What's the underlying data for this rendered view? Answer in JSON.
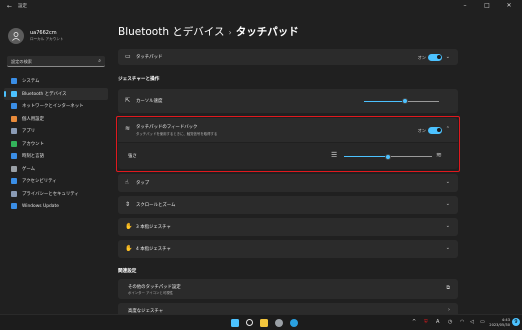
{
  "window": {
    "title": "設定",
    "back_glyph": "←",
    "minimize_glyph": "–",
    "maximize_glyph": "□",
    "close_glyph": "✕"
  },
  "user": {
    "name": "ua7662cm",
    "account": "ローカル アカウント"
  },
  "search": {
    "placeholder": "設定の検索",
    "icon": "search-icon"
  },
  "sidebar": {
    "items": [
      {
        "label": "システム",
        "color": "#3a8ee6"
      },
      {
        "label": "Bluetooth とデバイス",
        "color": "#4cc2ff",
        "active": true
      },
      {
        "label": "ネットワークとインターネット",
        "color": "#3a8ee6"
      },
      {
        "label": "個人用設定",
        "color": "#e88a3a"
      },
      {
        "label": "アプリ",
        "color": "#8a9bb5"
      },
      {
        "label": "アカウント",
        "color": "#33b35a"
      },
      {
        "label": "時刻と言語",
        "color": "#3a8ee6"
      },
      {
        "label": "ゲーム",
        "color": "#9aa0a6"
      },
      {
        "label": "アクセシビリティ",
        "color": "#3a8ee6"
      },
      {
        "label": "プライバシーとセキュリティ",
        "color": "#8a9bb5"
      },
      {
        "label": "Windows Update",
        "color": "#3a8ee6"
      }
    ]
  },
  "breadcrumb": {
    "parent": "Bluetooth とデバイス",
    "separator": "›",
    "current": "タッチパッド"
  },
  "touchpad": {
    "label": "タッチパッド",
    "state": "オン",
    "icon": "touchpad-icon"
  },
  "gestures_section": {
    "title": "ジェスチャーと操作"
  },
  "cursor_speed": {
    "label": "カーソル速度",
    "value": 0.55,
    "icon": "cursor-icon"
  },
  "haptics": {
    "label": "タッチパッドのフィードバック",
    "sub": "タッチパッドを使用するときに、触覚信号を取得する",
    "state": "オン",
    "intensity_label": "強さ",
    "intensity_value": 0.5
  },
  "rows": [
    {
      "label": "タップ",
      "icon": "tap-icon"
    },
    {
      "label": "スクロールとズーム",
      "icon": "scroll-icon"
    },
    {
      "label": "3 本指ジェスチャ",
      "icon": "three-finger-icon"
    },
    {
      "label": "4 本指ジェスチャ",
      "icon": "four-finger-icon"
    }
  ],
  "related_section": {
    "title": "関連設定",
    "items": [
      {
        "label": "その他のタッチパッド設定",
        "sub": "ポインター アイコンと可視性"
      },
      {
        "label": "高度なジェスチャ"
      }
    ]
  },
  "taskbar": {
    "icons": [
      {
        "name": "start",
        "color": "#4cc2ff"
      },
      {
        "name": "search",
        "color": "#e6e6e6"
      },
      {
        "name": "explorer",
        "color": "#f2c53d"
      },
      {
        "name": "settings",
        "color": "#9aa0a6"
      },
      {
        "name": "edge",
        "color": "#2aa0e0"
      }
    ],
    "tray_up": "^",
    "tray_lang": "A",
    "clock_time": "4:43",
    "clock_date": "2023/05/30",
    "notifications": "9"
  }
}
